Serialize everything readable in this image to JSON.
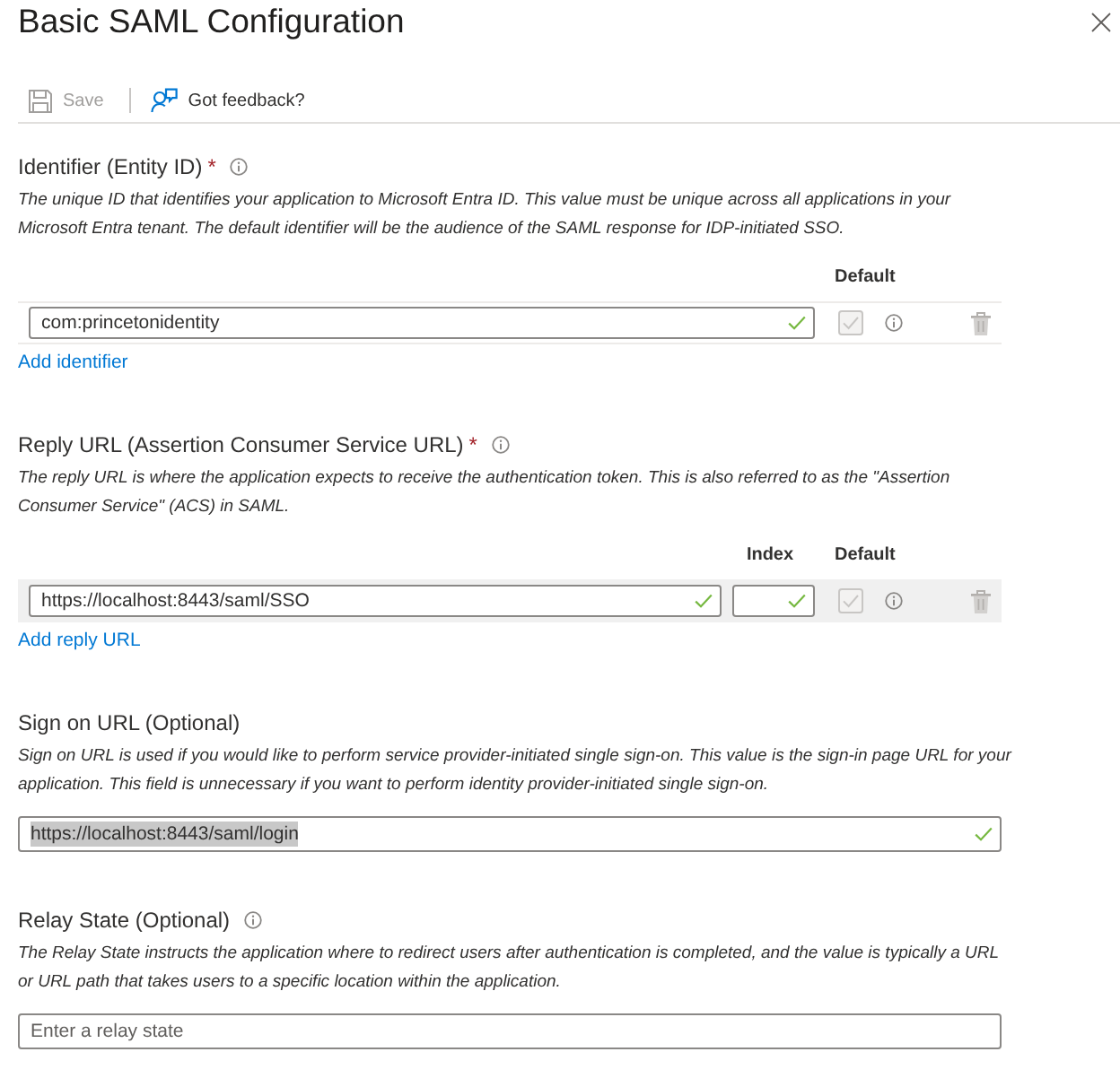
{
  "panel": {
    "title": "Basic SAML Configuration"
  },
  "toolbar": [
    {
      "kind": "save",
      "label": "Save",
      "disabled": true
    },
    {
      "kind": "feedback",
      "label": "Got feedback?",
      "disabled": false
    }
  ],
  "sections": [
    {
      "kind": "list",
      "label": "Identifier (Entity ID)",
      "required_mark": "*",
      "info": true,
      "description": "The unique ID that identifies your application to Microsoft Entra ID. This value must be unique across all applications in your Microsoft Entra tenant. The default identifier will be the audience of the SAML response for IDP-initiated SSO.",
      "columns": [
        {
          "kind": "default",
          "label": "Default"
        }
      ],
      "rows": [
        {
          "highlighted": false,
          "field": {
            "value": "com:princetonidentity",
            "valid": true
          },
          "default": {
            "checked": true,
            "disabled": true
          }
        }
      ],
      "add_link": "Add identifier"
    },
    {
      "kind": "list",
      "label": "Reply URL (Assertion Consumer Service URL)",
      "required_mark": "*",
      "info": true,
      "description": "The reply URL is where the application expects to receive the authentication token. This is also referred to as the \"Assertion Consumer Service\" (ACS) in SAML.",
      "columns": [
        {
          "kind": "index",
          "label": "Index"
        },
        {
          "kind": "default",
          "label": "Default"
        }
      ],
      "rows": [
        {
          "highlighted": true,
          "field": {
            "value": "https://localhost:8443/saml/SSO",
            "valid": true
          },
          "index": {
            "valid": true
          },
          "default": {
            "checked": true,
            "disabled": true
          }
        }
      ],
      "add_link": "Add reply URL"
    },
    {
      "kind": "single",
      "label": "Sign on URL (Optional)",
      "info": false,
      "description": "Sign on URL is used if you would like to perform service provider-initiated single sign-on. This value is the sign-in page URL for your application. This field is unnecessary if you want to perform identity provider-initiated single sign-on.",
      "field": {
        "value": "https://localhost:8443/saml/login",
        "valid": true,
        "text_highlighted": true
      }
    },
    {
      "kind": "single",
      "label": "Relay State (Optional)",
      "info": true,
      "description": "The Relay State instructs the application where to redirect users after authentication is completed, and the value is typically a URL or URL path that takes users to a specific location within the application.",
      "field": {
        "placeholder": "Enter a relay state"
      }
    }
  ]
}
